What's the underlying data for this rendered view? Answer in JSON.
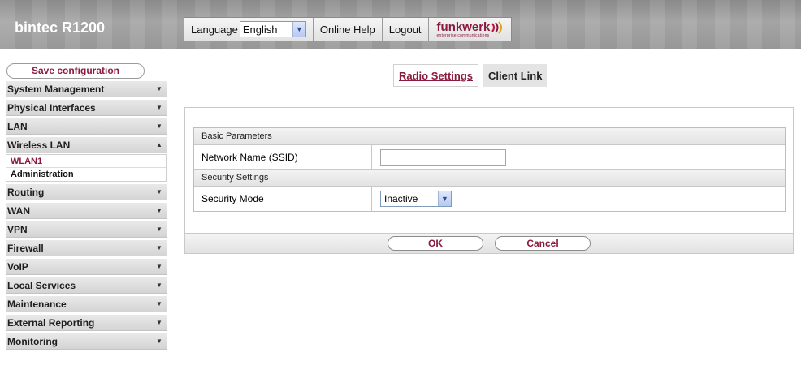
{
  "header": {
    "brand": "bintec R1200",
    "language_label": "Language",
    "language_value": "English",
    "online_help": "Online Help",
    "logout": "Logout",
    "logo_text": "funkwerk",
    "logo_tagline": "enterprise communications"
  },
  "sidebar": {
    "save_configuration": "Save configuration",
    "items": [
      {
        "label": "System Management"
      },
      {
        "label": "Physical Interfaces"
      },
      {
        "label": "LAN"
      },
      {
        "label": "Wireless LAN"
      },
      {
        "label": "Routing"
      },
      {
        "label": "WAN"
      },
      {
        "label": "VPN"
      },
      {
        "label": "Firewall"
      },
      {
        "label": "VoIP"
      },
      {
        "label": "Local Services"
      },
      {
        "label": "Maintenance"
      },
      {
        "label": "External Reporting"
      },
      {
        "label": "Monitoring"
      }
    ],
    "wireless_sub": [
      {
        "label": "WLAN1"
      },
      {
        "label": "Administration"
      }
    ]
  },
  "tabs": [
    {
      "label": "Radio Settings"
    },
    {
      "label": "Client Link"
    }
  ],
  "form": {
    "basic_parameters": "Basic Parameters",
    "network_name_label": "Network Name (SSID)",
    "network_name_value": "",
    "security_settings": "Security Settings",
    "security_mode_label": "Security Mode",
    "security_mode_value": "Inactive"
  },
  "buttons": {
    "ok": "OK",
    "cancel": "Cancel"
  },
  "colors": {
    "accent": "#8a1b3d",
    "header_bg": "#9c9c9c",
    "menu_bg": "#dcdcdc"
  }
}
